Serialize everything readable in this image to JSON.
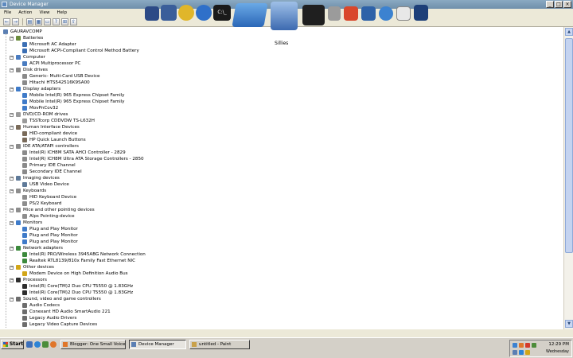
{
  "window": {
    "title": "Device Manager"
  },
  "menu": [
    "File",
    "Action",
    "View",
    "Help"
  ],
  "dock": {
    "label": "Sillies"
  },
  "tree": [
    {
      "level": 0,
      "label": "GAURAVCOMP",
      "icon": "computer-icon",
      "color": "#5b7fb3"
    },
    {
      "level": 1,
      "label": "Batteries",
      "icon": "battery-icon",
      "color": "#6a8d3d",
      "exp": "-"
    },
    {
      "level": 2,
      "label": "Microsoft AC Adapter",
      "icon": "adapter-icon",
      "color": "#3b6fb4"
    },
    {
      "level": 2,
      "label": "Microsoft ACPI-Compliant Control Method Battery",
      "icon": "battery-icon",
      "color": "#3b6fb4"
    },
    {
      "level": 1,
      "label": "Computer",
      "icon": "computer-icon",
      "color": "#4a7cc0",
      "exp": "-"
    },
    {
      "level": 2,
      "label": "ACPI Multiprocessor PC",
      "icon": "computer-icon",
      "color": "#4a7cc0"
    },
    {
      "level": 1,
      "label": "Disk drives",
      "icon": "disk-icon",
      "color": "#8a8a8a",
      "exp": "-"
    },
    {
      "level": 2,
      "label": "Generic- Multi-Card USB Device",
      "icon": "disk-icon",
      "color": "#8a8a8a"
    },
    {
      "level": 2,
      "label": "Hitachi HTS542516K9SA00",
      "icon": "disk-icon",
      "color": "#8a8a8a"
    },
    {
      "level": 1,
      "label": "Display adapters",
      "icon": "display-icon",
      "color": "#3f7bc9",
      "exp": "-"
    },
    {
      "level": 2,
      "label": "Mobile Intel(R) 965 Express Chipset Family",
      "icon": "display-icon",
      "color": "#3f7bc9"
    },
    {
      "level": 2,
      "label": "Mobile Intel(R) 965 Express Chipset Family",
      "icon": "display-icon",
      "color": "#3f7bc9"
    },
    {
      "level": 2,
      "label": "MovPnCov32",
      "icon": "display-icon",
      "color": "#3f7bc9"
    },
    {
      "level": 1,
      "label": "DVD/CD-ROM drives",
      "icon": "cdrom-icon",
      "color": "#9a9a9a",
      "exp": "-"
    },
    {
      "level": 2,
      "label": "TSSTcorp CDDVDW TS-L632H",
      "icon": "cdrom-icon",
      "color": "#9a9a9a"
    },
    {
      "level": 1,
      "label": "Human Interface Devices",
      "icon": "hid-icon",
      "color": "#7a6b5a",
      "exp": "-"
    },
    {
      "level": 2,
      "label": "HID-compliant device",
      "icon": "hid-icon",
      "color": "#7a6b5a"
    },
    {
      "level": 2,
      "label": "HP Quick Launch Buttons",
      "icon": "hid-icon",
      "color": "#7a6b5a"
    },
    {
      "level": 1,
      "label": "IDE ATA/ATAPI controllers",
      "icon": "controller-icon",
      "color": "#8a8a8a",
      "exp": "-"
    },
    {
      "level": 2,
      "label": "Intel(R) ICH8M SATA AHCI Controller - 2829",
      "icon": "controller-icon",
      "color": "#8a8a8a"
    },
    {
      "level": 2,
      "label": "Intel(R) ICH8M Ultra ATA Storage Controllers - 2850",
      "icon": "controller-icon",
      "color": "#8a8a8a"
    },
    {
      "level": 2,
      "label": "Primary IDE Channel",
      "icon": "controller-icon",
      "color": "#8a8a8a"
    },
    {
      "level": 2,
      "label": "Secondary IDE Channel",
      "icon": "controller-icon",
      "color": "#8a8a8a"
    },
    {
      "level": 1,
      "label": "Imaging devices",
      "icon": "camera-icon",
      "color": "#5f7a99",
      "exp": "-"
    },
    {
      "level": 2,
      "label": "USB Video Device",
      "icon": "camera-icon",
      "color": "#5f7a99"
    },
    {
      "level": 1,
      "label": "Keyboards",
      "icon": "keyboard-icon",
      "color": "#8d8d8d",
      "exp": "-"
    },
    {
      "level": 2,
      "label": "HID Keyboard Device",
      "icon": "keyboard-icon",
      "color": "#8d8d8d"
    },
    {
      "level": 2,
      "label": "PS/2 Keyboard",
      "icon": "keyboard-icon",
      "color": "#8d8d8d"
    },
    {
      "level": 1,
      "label": "Mice and other pointing devices",
      "icon": "mouse-icon",
      "color": "#8d8d8d",
      "exp": "-"
    },
    {
      "level": 2,
      "label": "Alps Pointing-device",
      "icon": "mouse-icon",
      "color": "#8d8d8d"
    },
    {
      "level": 1,
      "label": "Monitors",
      "icon": "monitor-icon",
      "color": "#3f7bc9",
      "exp": "-"
    },
    {
      "level": 2,
      "label": "Plug and Play Monitor",
      "icon": "monitor-icon",
      "color": "#3f7bc9"
    },
    {
      "level": 2,
      "label": "Plug and Play Monitor",
      "icon": "monitor-icon",
      "color": "#3f7bc9"
    },
    {
      "level": 2,
      "label": "Plug and Play Monitor",
      "icon": "monitor-icon",
      "color": "#3f7bc9"
    },
    {
      "level": 1,
      "label": "Network adapters",
      "icon": "network-icon",
      "color": "#3c8a3c",
      "exp": "-"
    },
    {
      "level": 2,
      "label": "Intel(R) PRO/Wireless 3945ABG Network Connection",
      "icon": "network-icon",
      "color": "#3c8a3c"
    },
    {
      "level": 2,
      "label": "Realtek RTL8139/810x Family Fast Ethernet NIC",
      "icon": "network-icon",
      "color": "#3c8a3c"
    },
    {
      "level": 1,
      "label": "Other devices",
      "icon": "question-icon",
      "color": "#d2a619",
      "exp": "-"
    },
    {
      "level": 2,
      "label": "Modem Device on High Definition Audio Bus",
      "icon": "question-icon",
      "color": "#d2a619"
    },
    {
      "level": 1,
      "label": "Processors",
      "icon": "processor-icon",
      "color": "#2e2e2e",
      "exp": "-"
    },
    {
      "level": 2,
      "label": "Intel(R) Core(TM)2 Duo CPU     T5550  @ 1.83GHz",
      "icon": "processor-icon",
      "color": "#2e2e2e"
    },
    {
      "level": 2,
      "label": "Intel(R) Core(TM)2 Duo CPU     T5550  @ 1.83GHz",
      "icon": "processor-icon",
      "color": "#2e2e2e"
    },
    {
      "level": 1,
      "label": "Sound, video and game controllers",
      "icon": "sound-icon",
      "color": "#6d6d6d",
      "exp": "-"
    },
    {
      "level": 2,
      "label": "Audio Codecs",
      "icon": "sound-icon",
      "color": "#6d6d6d"
    },
    {
      "level": 2,
      "label": "Conexant HD Audio SmartAudio 221",
      "icon": "sound-icon",
      "color": "#6d6d6d"
    },
    {
      "level": 2,
      "label": "Legacy Audio Drivers",
      "icon": "sound-icon",
      "color": "#6d6d6d"
    },
    {
      "level": 2,
      "label": "Legacy Video Capture Devices",
      "icon": "sound-icon",
      "color": "#6d6d6d"
    }
  ],
  "taskbar": {
    "start": "Start",
    "tasks": [
      {
        "label": "Blogger: One Small Voice...",
        "icon": "firefox-icon",
        "color": "#e0762a",
        "active": false
      },
      {
        "label": "Device Manager",
        "icon": "device-manager-icon",
        "color": "#5b7fb3",
        "active": true
      },
      {
        "label": "untitled - Paint",
        "icon": "paint-icon",
        "color": "#c9a14a",
        "active": false
      }
    ],
    "time": "12:29 PM",
    "date": "Wednesday"
  }
}
